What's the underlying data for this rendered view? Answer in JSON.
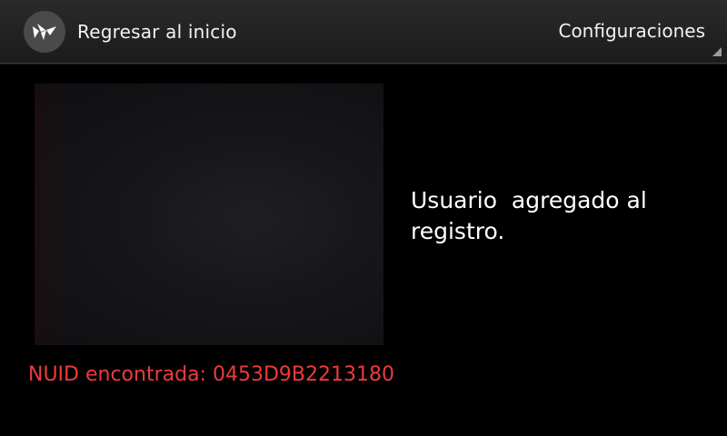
{
  "header": {
    "home_label": "Regresar al inicio",
    "settings_label": "Configuraciones",
    "icon": "kivy-logo-icon"
  },
  "main": {
    "status_message": "Usuario  agregado al registro.",
    "nuid_text": "NUID encontrada: 0453D9B2213180"
  },
  "colors": {
    "background": "#000000",
    "action_bar": "#232323",
    "nuid_text": "#f03a3a",
    "status_text": "#ffffff"
  }
}
